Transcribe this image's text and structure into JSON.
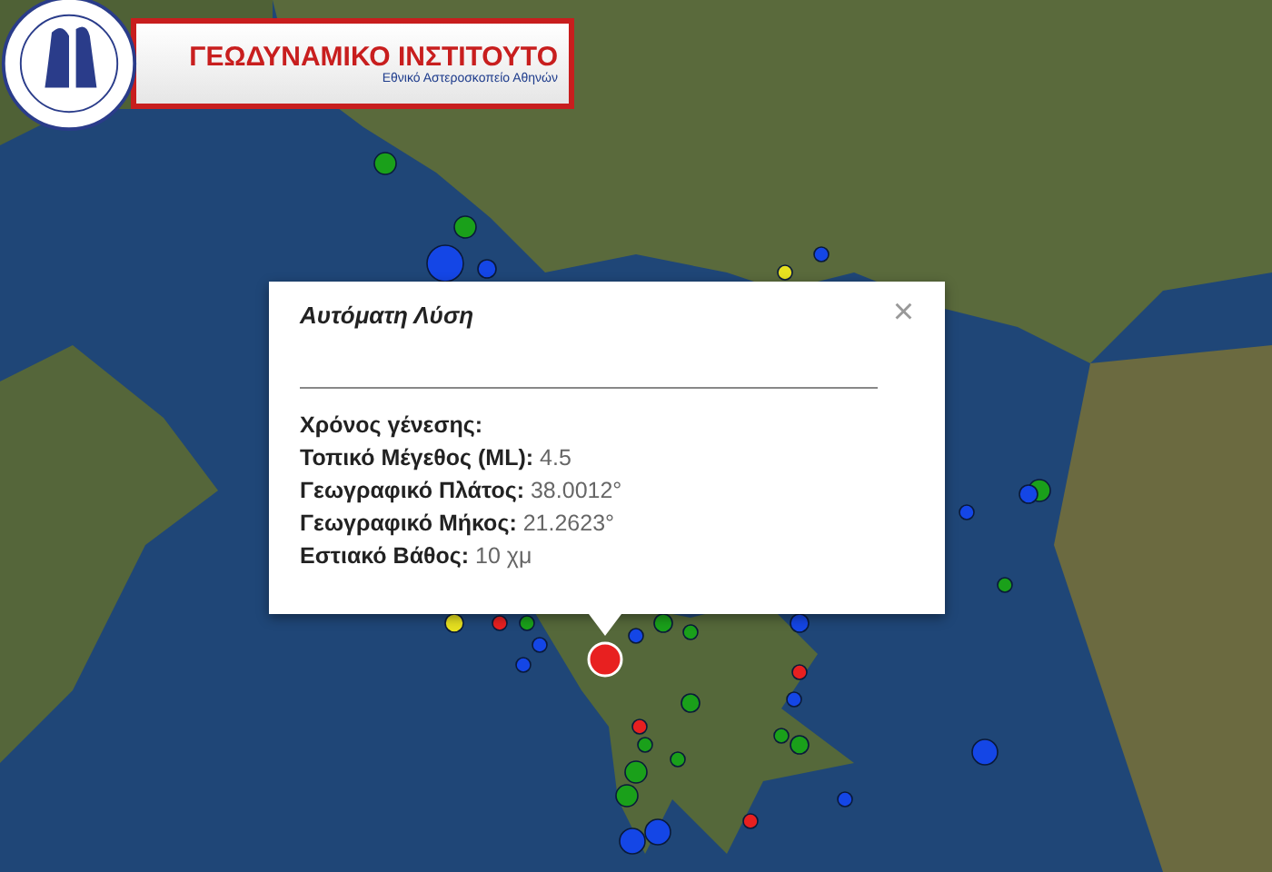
{
  "logo": {
    "title": "ΓΕΩΔΥΝΑΜΙΚΟ ΙΝΣΤΙΤΟΥΤΟ",
    "subtitle": "Εθνικό Αστεροσκοπείο Αθηνών"
  },
  "markers": [
    {
      "color": "#1aa01a",
      "selected": false
    },
    {
      "color": "#1446e6",
      "selected": false
    },
    {
      "color": "#1aa01a",
      "selected": false
    },
    {
      "color": "#1446e6",
      "selected": false
    },
    {
      "color": "#e6e020",
      "selected": false
    },
    {
      "color": "#1446e6",
      "selected": false
    },
    {
      "color": "#1aa01a",
      "selected": false
    },
    {
      "color": "#1446e6",
      "selected": false
    },
    {
      "color": "#1446e6",
      "selected": false
    },
    {
      "color": "#1aa01a",
      "selected": false
    },
    {
      "color": "#1446e6",
      "selected": false
    },
    {
      "color": "#e6e020",
      "selected": false
    },
    {
      "color": "#e82020",
      "selected": false
    },
    {
      "color": "#1aa01a",
      "selected": false
    },
    {
      "color": "#1446e6",
      "selected": false
    },
    {
      "color": "#1aa01a",
      "selected": false
    },
    {
      "color": "#1aa01a",
      "selected": false
    },
    {
      "color": "#1446e6",
      "selected": false
    },
    {
      "color": "#1446e6",
      "selected": false
    },
    {
      "color": "#1aa01a",
      "selected": false
    },
    {
      "color": "#e82020",
      "selected": false
    },
    {
      "color": "#1aa01a",
      "selected": false
    },
    {
      "color": "#1aa01a",
      "selected": false
    },
    {
      "color": "#1aa01a",
      "selected": false
    },
    {
      "color": "#1446e6",
      "selected": false
    },
    {
      "color": "#1446e6",
      "selected": false
    },
    {
      "color": "#1aa01a",
      "selected": false
    },
    {
      "color": "#1aa01a",
      "selected": false
    },
    {
      "color": "#1446e6",
      "selected": false
    },
    {
      "color": "#e82020",
      "selected": false
    },
    {
      "color": "#1446e6",
      "selected": false
    },
    {
      "color": "#1446e6",
      "selected": false
    },
    {
      "color": "#e82020",
      "selected": false
    },
    {
      "color": "#1aa01a",
      "selected": false
    },
    {
      "color": "#e82020",
      "selected": true
    }
  ],
  "popup": {
    "title": "Αυτόματη Λύση",
    "close": "×",
    "fields": [
      {
        "label": "Χρόνος γένεσης:"
      },
      {
        "label": "Τοπικό Μέγεθος (ML):",
        "value": "4.5"
      },
      {
        "label": "Γεωγραφικό Πλάτος:",
        "value": "38.0012°"
      },
      {
        "label": "Γεωγραφικό Μήκος:",
        "value": "21.2623°"
      },
      {
        "label": "Εστιακό Βάθος:",
        "value": "10 χμ"
      }
    ]
  }
}
